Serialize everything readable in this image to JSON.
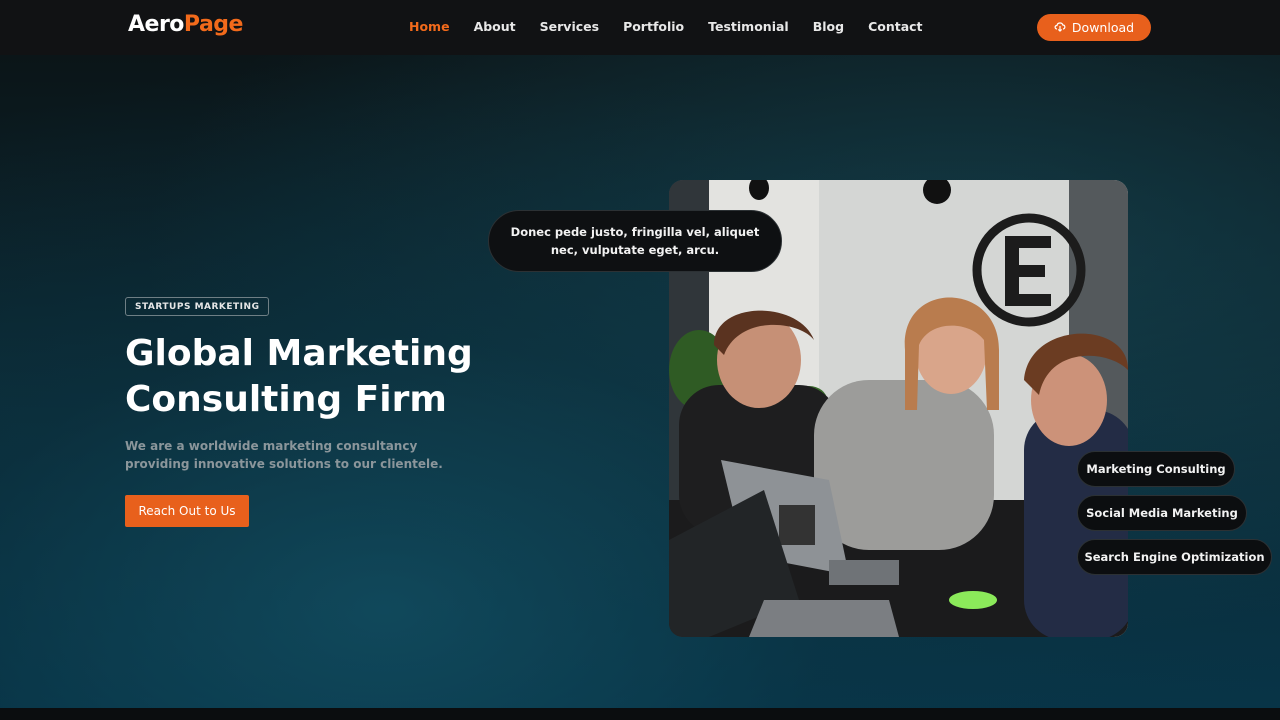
{
  "header": {
    "logo_part1": "Aero",
    "logo_part2": "Page",
    "nav": [
      "Home",
      "About",
      "Services",
      "Portfolio",
      "Testimonial",
      "Blog",
      "Contact"
    ],
    "active_nav": "Home",
    "download_label": "Download",
    "download_icon": "cloud-download-icon"
  },
  "hero": {
    "tag": "STARTUPS MARKETING",
    "title_line1": "Global Marketing",
    "title_line2": "Consulting Firm",
    "subtitle": "We are a worldwide marketing consultancy providing innovative solutions to our clientele.",
    "cta_label": "Reach Out to Us",
    "bubble": "Donec pede justo, fringilla vel, aliquet nec, vulputate eget, arcu.",
    "services": [
      "Marketing Consulting",
      "Social Media Marketing",
      "Search Engine Optimization"
    ]
  },
  "colors": {
    "accent": "#e8601c",
    "header_bg": "#111214",
    "hero_dark": "#0b1518",
    "hero_teal": "#0c2a35"
  }
}
